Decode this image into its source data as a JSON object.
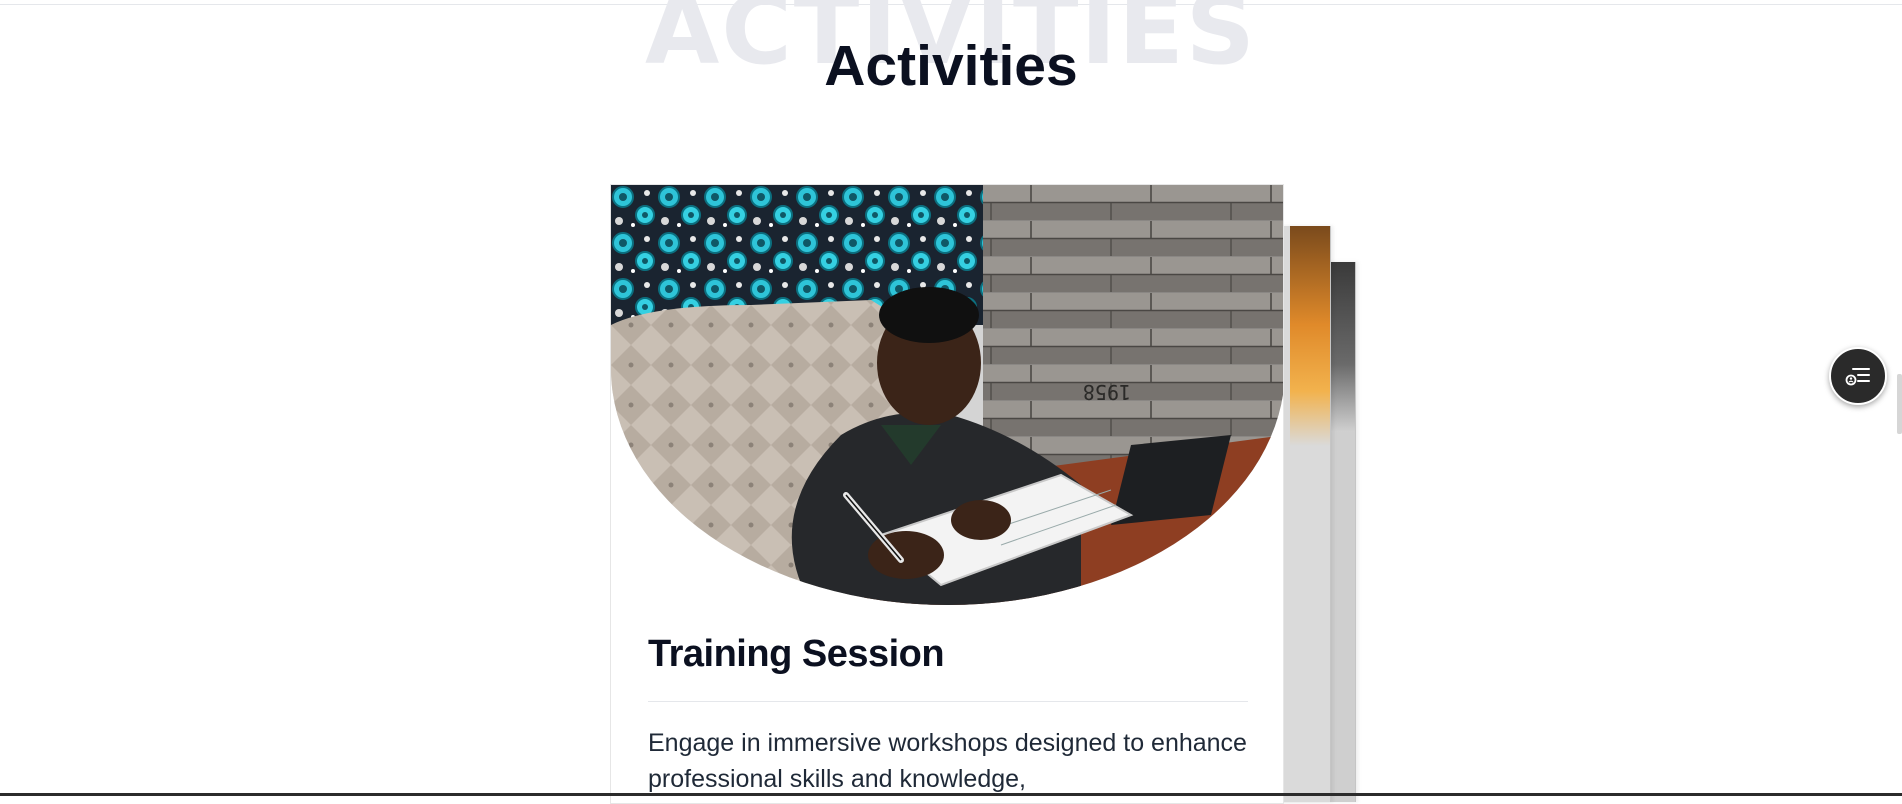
{
  "section": {
    "watermark": "ACTIVITIES",
    "title": "Activities"
  },
  "card": {
    "image_icon": "photo-student-studying",
    "title": "Training Session",
    "description": "Engage in immersive workshops designed to enhance professional skills and knowledge,"
  },
  "float_button": {
    "icon": "accessibility-list-icon"
  },
  "colors": {
    "title": "#0b1020",
    "watermark": "#e8e9ee",
    "float_button_bg": "#2a2a2a"
  }
}
